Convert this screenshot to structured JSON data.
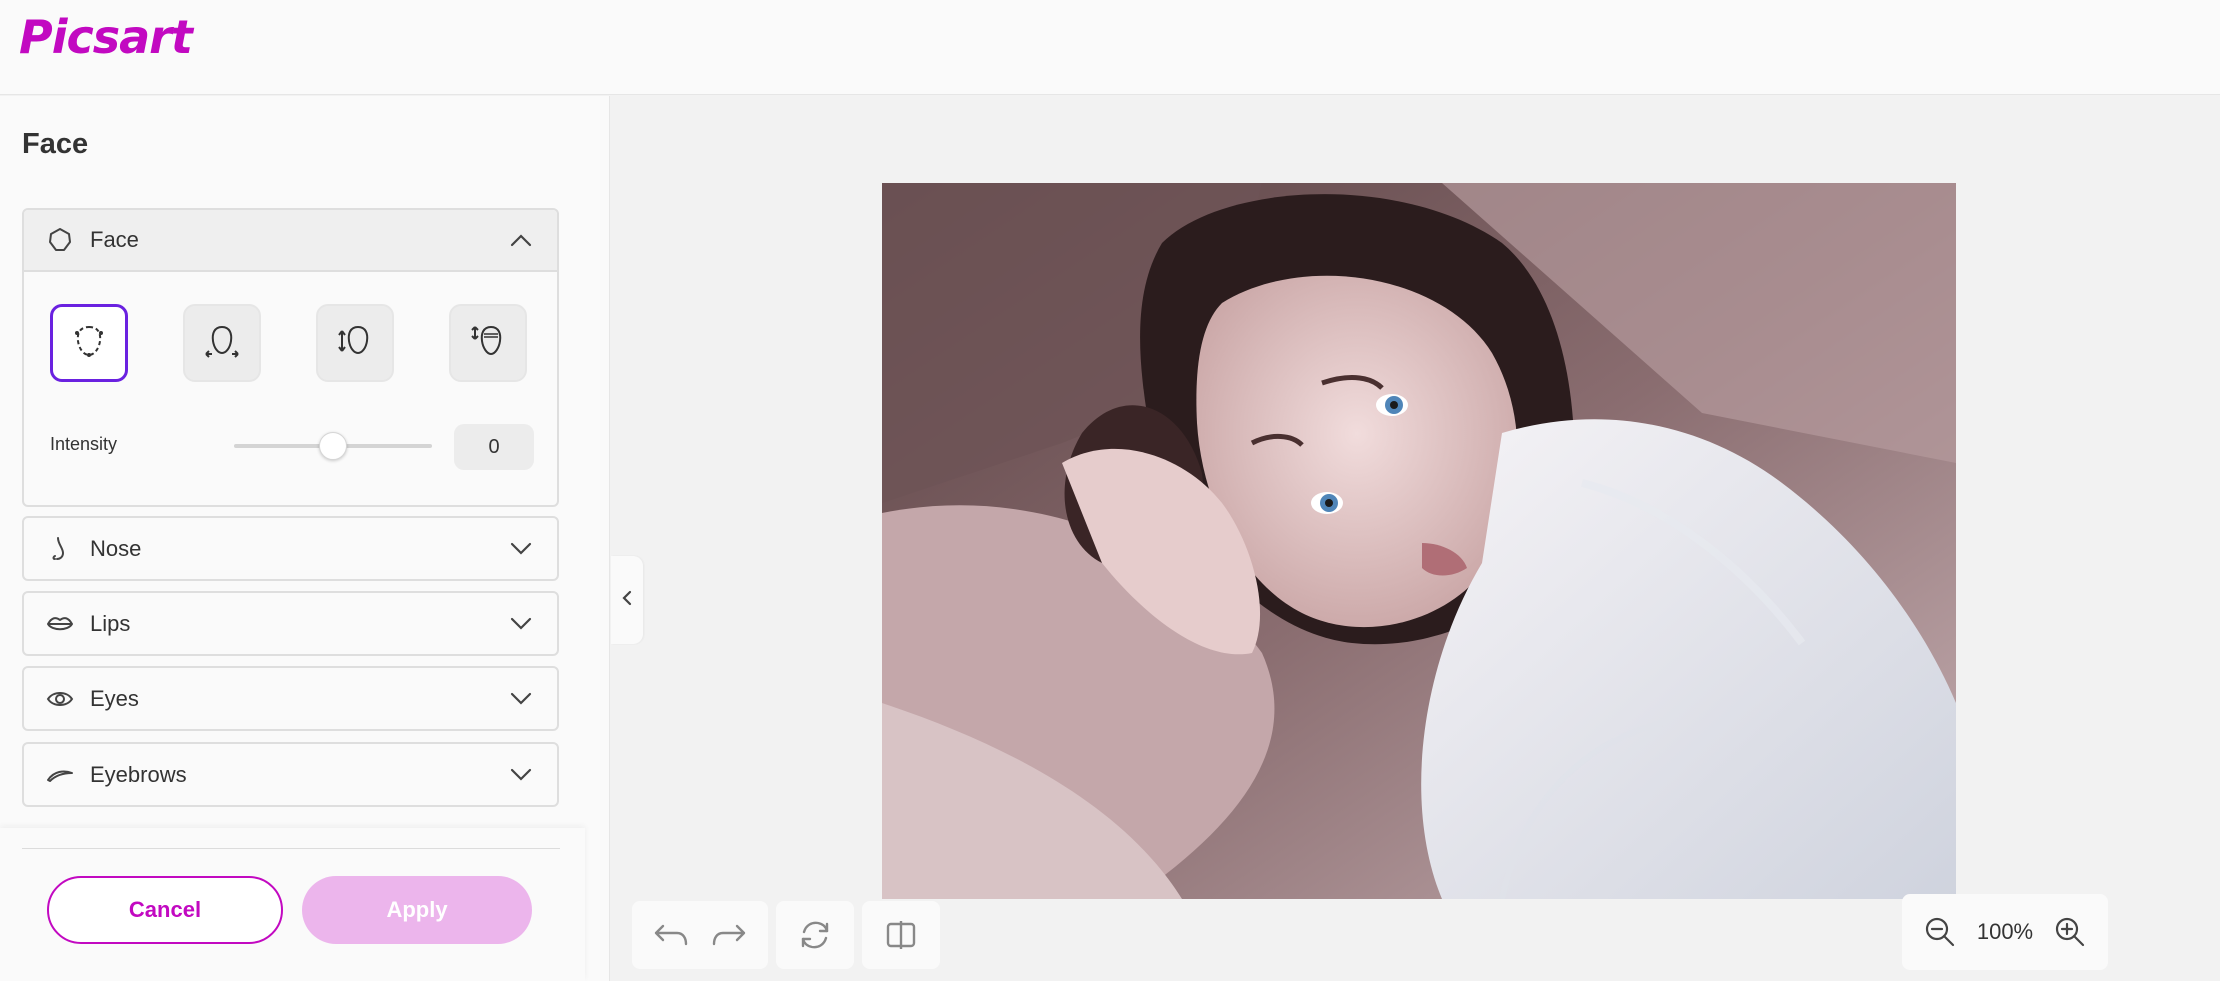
{
  "app": {
    "logo": "Picsart",
    "brand_color": "#c209c1",
    "accent_color": "#6a21e0"
  },
  "sidebar": {
    "title": "Face",
    "sections": [
      {
        "label": "Face",
        "icon": "face-outline-icon",
        "expanded": true
      },
      {
        "label": "Nose",
        "icon": "nose-icon",
        "expanded": false
      },
      {
        "label": "Lips",
        "icon": "lips-icon",
        "expanded": false
      },
      {
        "label": "Eyes",
        "icon": "eye-icon",
        "expanded": false
      },
      {
        "label": "Eyebrows",
        "icon": "eyebrow-icon",
        "expanded": false
      }
    ],
    "face_tools": [
      "face-shape-icon",
      "face-width-icon",
      "face-height-icon",
      "forehead-icon"
    ],
    "intensity": {
      "label": "Intensity",
      "value": "0",
      "level": 0.5
    }
  },
  "actions": {
    "cancel_label": "Cancel",
    "apply_label": "Apply"
  },
  "canvas": {
    "zoom": "100%"
  },
  "toolbar": {
    "icons": [
      "undo-icon",
      "redo-icon",
      "reset-icon",
      "compare-icon"
    ]
  }
}
